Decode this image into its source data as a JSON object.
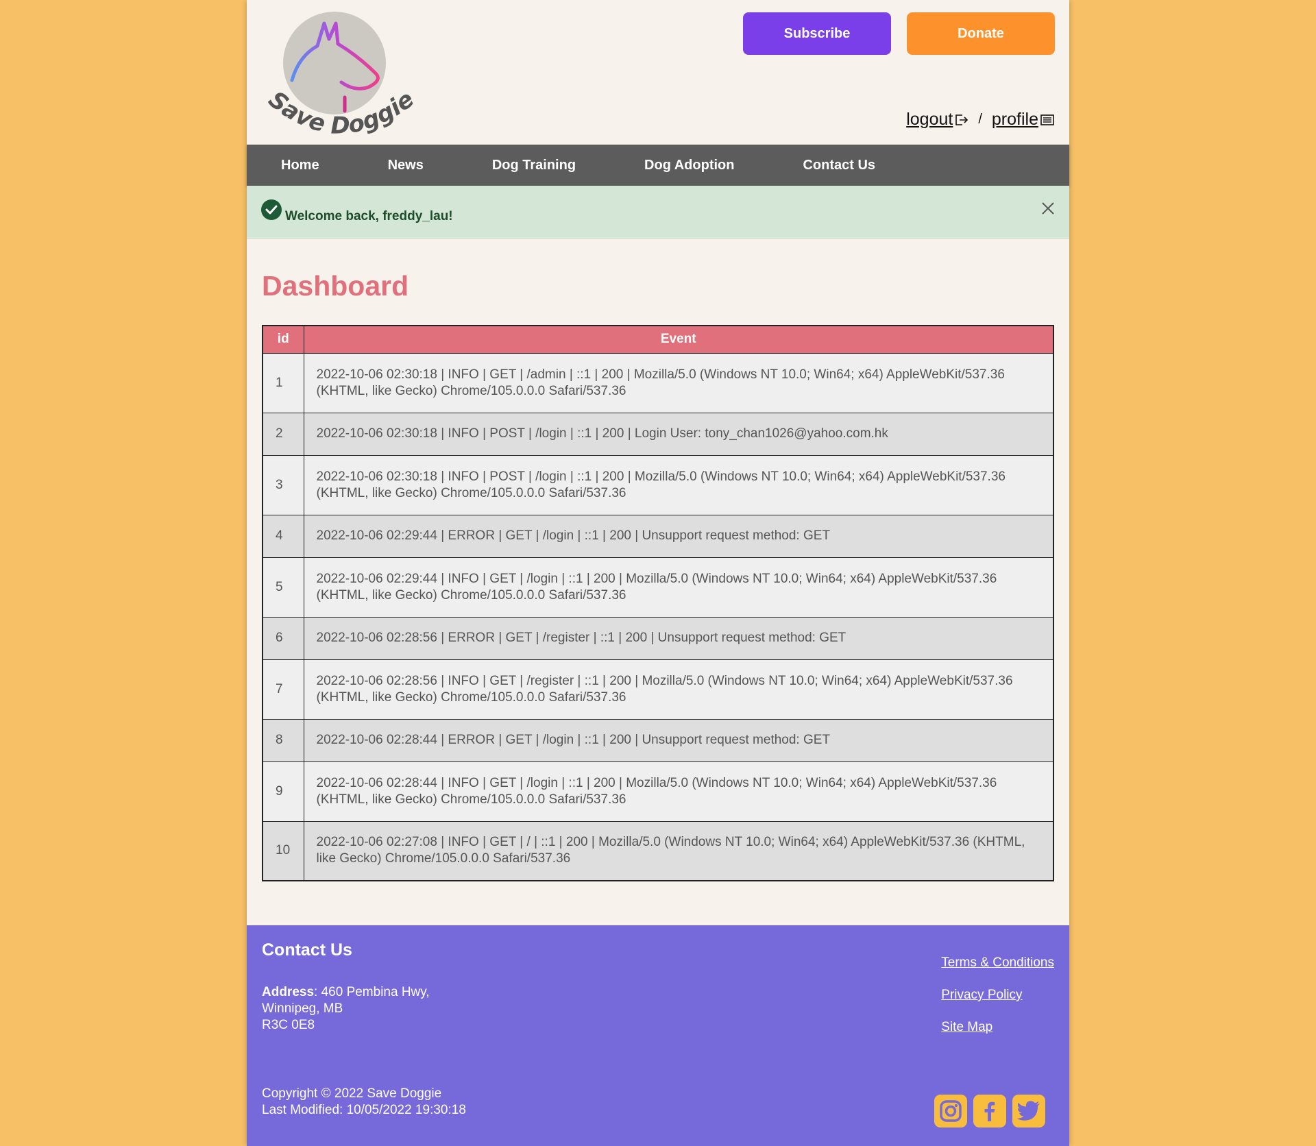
{
  "brand": {
    "logo_text": "Save Doggie"
  },
  "header": {
    "subscribe_label": "Subscribe",
    "donate_label": "Donate",
    "logout_label": "logout",
    "separator": "/",
    "profile_label": "profile"
  },
  "nav": {
    "items": [
      {
        "label": "Home"
      },
      {
        "label": "News"
      },
      {
        "label": "Dog Training"
      },
      {
        "label": "Dog Adoption"
      },
      {
        "label": "Contact Us"
      }
    ]
  },
  "alert": {
    "message": "Welcome back, freddy_lau!"
  },
  "main": {
    "title": "Dashboard"
  },
  "table": {
    "headers": [
      "id",
      "Event"
    ],
    "rows": [
      {
        "id": "1",
        "event": "2022-10-06 02:30:18 | INFO | GET | /admin | ::1 | 200 | Mozilla/5.0 (Windows NT 10.0; Win64; x64) AppleWebKit/537.36 (KHTML, like Gecko) Chrome/105.0.0.0 Safari/537.36"
      },
      {
        "id": "2",
        "event": "2022-10-06 02:30:18 | INFO | POST | /login | ::1 | 200 | Login User: tony_chan1026@yahoo.com.hk"
      },
      {
        "id": "3",
        "event": "2022-10-06 02:30:18 | INFO | POST | /login | ::1 | 200 | Mozilla/5.0 (Windows NT 10.0; Win64; x64) AppleWebKit/537.36 (KHTML, like Gecko) Chrome/105.0.0.0 Safari/537.36"
      },
      {
        "id": "4",
        "event": "2022-10-06 02:29:44 | ERROR | GET | /login | ::1 | 200 | Unsupport request method: GET"
      },
      {
        "id": "5",
        "event": "2022-10-06 02:29:44 | INFO | GET | /login | ::1 | 200 | Mozilla/5.0 (Windows NT 10.0; Win64; x64) AppleWebKit/537.36 (KHTML, like Gecko) Chrome/105.0.0.0 Safari/537.36"
      },
      {
        "id": "6",
        "event": "2022-10-06 02:28:56 | ERROR | GET | /register | ::1 | 200 | Unsupport request method: GET"
      },
      {
        "id": "7",
        "event": "2022-10-06 02:28:56 | INFO | GET | /register | ::1 | 200 | Mozilla/5.0 (Windows NT 10.0; Win64; x64) AppleWebKit/537.36 (KHTML, like Gecko) Chrome/105.0.0.0 Safari/537.36"
      },
      {
        "id": "8",
        "event": "2022-10-06 02:28:44 | ERROR | GET | /login | ::1 | 200 | Unsupport request method: GET"
      },
      {
        "id": "9",
        "event": "2022-10-06 02:28:44 | INFO | GET | /login | ::1 | 200 | Mozilla/5.0 (Windows NT 10.0; Win64; x64) AppleWebKit/537.36 (KHTML, like Gecko) Chrome/105.0.0.0 Safari/537.36"
      },
      {
        "id": "10",
        "event": "2022-10-06 02:27:08 | INFO | GET | / | ::1 | 200 | Mozilla/5.0 (Windows NT 10.0; Win64; x64) AppleWebKit/537.36 (KHTML, like Gecko) Chrome/105.0.0.0 Safari/537.36"
      }
    ]
  },
  "footer": {
    "title": "Contact Us",
    "address_label": "Address",
    "address_line1": ": 460 Pembina Hwy,",
    "address_line2": "Winnipeg, MB",
    "address_line3": "R3C 0E8",
    "copyright": "Copyright © 2022 Save Doggie",
    "last_modified": "Last Modified: 10/05/2022 19:30:18",
    "links": [
      {
        "label": "Terms & Conditions"
      },
      {
        "label": "Privacy Policy"
      },
      {
        "label": "Site Map"
      }
    ],
    "social_icons": [
      "instagram-icon",
      "facebook-icon",
      "twitter-icon"
    ]
  },
  "colors": {
    "background": "#f7c066",
    "page": "#f7f3ec",
    "subscribe": "#7a3fe8",
    "donate": "#fd922c",
    "nav": "#5c5c5c",
    "accent": "#e0707b",
    "footer": "#7669d9",
    "alert_bg": "#d4e6d5"
  }
}
